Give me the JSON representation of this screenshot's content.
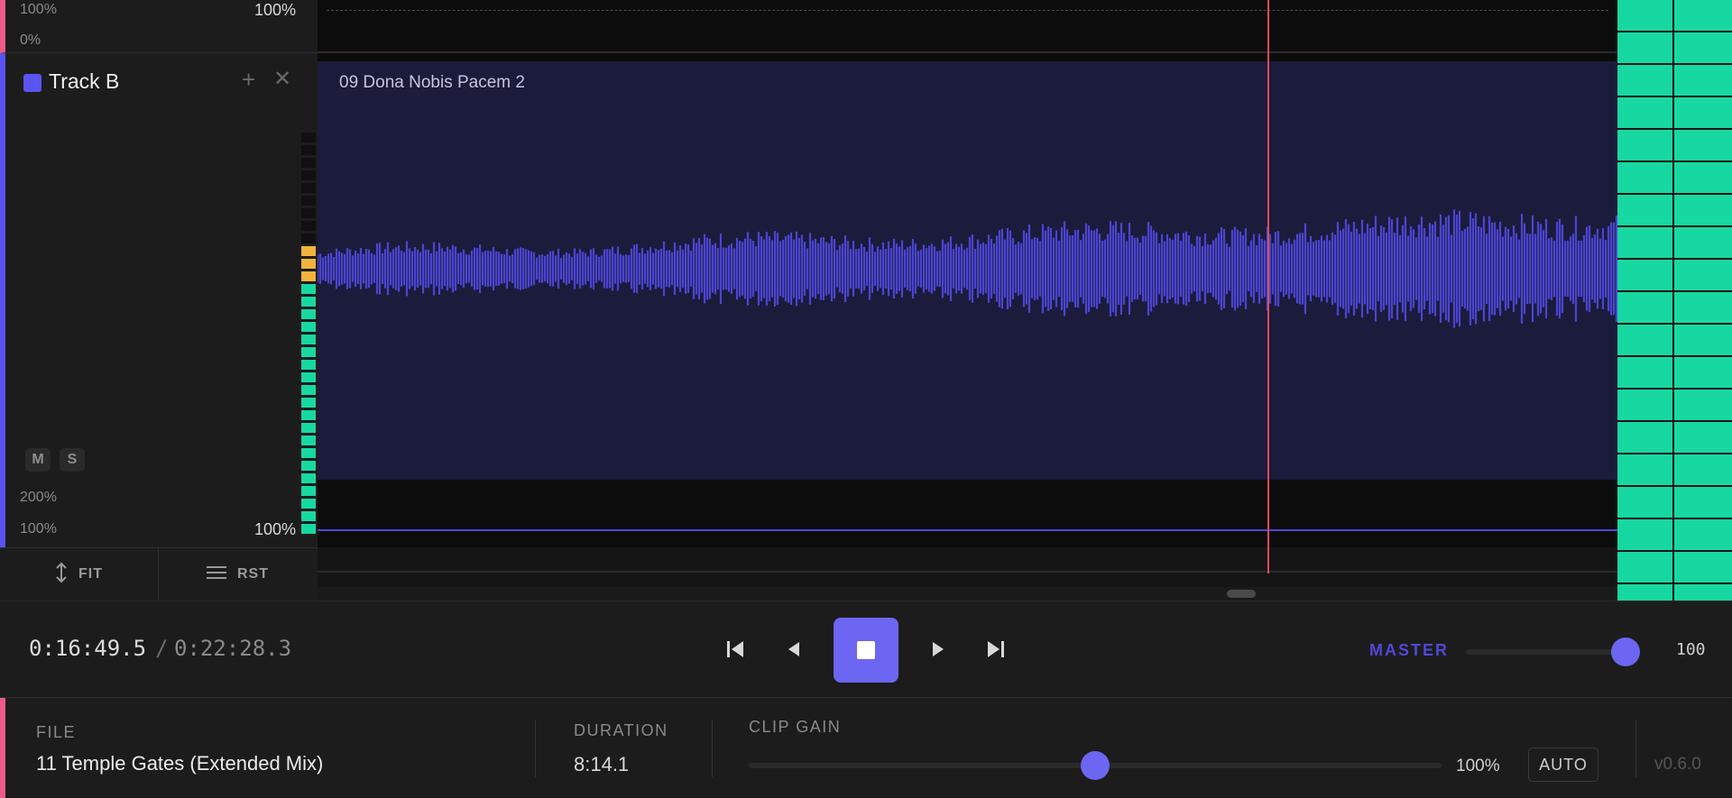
{
  "prev_track": {
    "volume_left": "100%",
    "volume_right": "100%",
    "pan_min": "0%"
  },
  "track_b": {
    "name": "Track B",
    "color": "#5b54f2",
    "mute_label": "M",
    "solo_label": "S",
    "zoom_max": "200%",
    "volume_left": "100%",
    "volume_right": "100%",
    "clip_name": "09 Dona Nobis Pacem 2"
  },
  "track_tools": {
    "fit_label": "FIT",
    "rst_label": "RST"
  },
  "transport": {
    "current_time": "0:16:49.5",
    "separator": "/",
    "total_time": "0:22:28.3",
    "master_label": "MASTER",
    "master_value": "100",
    "master_level": 1.0
  },
  "info": {
    "file_caption": "FILE",
    "file_name": "11 Temple Gates (Extended Mix)",
    "duration_caption": "DURATION",
    "duration_value": "8:14.1",
    "clip_gain_caption": "CLIP GAIN",
    "clip_gain_value": "100%",
    "clip_gain_level": 0.5,
    "auto_label": "AUTO",
    "version": "v0.6.0"
  },
  "colors": {
    "accent": "#6c66f2",
    "meter_green": "#18d8a2",
    "meter_yellow": "#f2b33d",
    "playhead": "#e8495b",
    "track_pink": "#ee5a86"
  },
  "icons": {
    "skip_start": "skip-to-start-icon",
    "prev": "step-back-icon",
    "stop": "stop-icon",
    "next": "play-icon",
    "skip_end": "skip-to-end-icon",
    "fit": "vertical-resize-icon",
    "rst": "menu-lines-icon"
  }
}
